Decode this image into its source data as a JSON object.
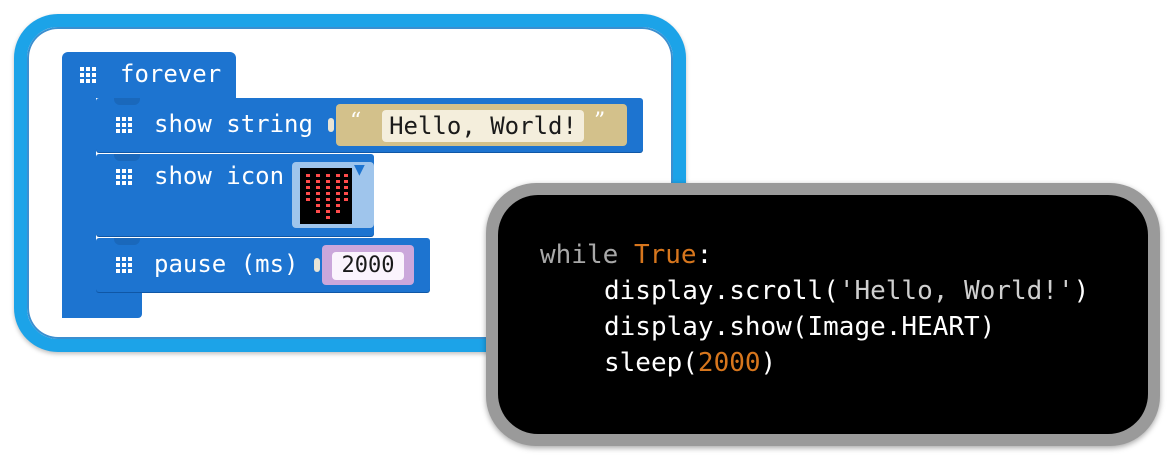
{
  "blocks": {
    "forever_label": "forever",
    "show_string_label": "show string",
    "string_value": "Hello, World!",
    "open_quote": "“",
    "close_quote": "”",
    "show_icon_label": "show icon",
    "icon_dropdown": "▼",
    "pause_label": "pause (ms)",
    "pause_value": "2000",
    "colors": {
      "block": "#1d74d0",
      "string_slot": "#d3c18b",
      "number_slot": "#cba7db",
      "icon_slot": "#9fc5ec",
      "panel_border": "#1ca3e8"
    }
  },
  "code": {
    "line1_kw": "while",
    "line1_const": "True",
    "line1_rest": ":",
    "line2": "display.scroll(",
    "line2_str": "'Hello, World!'",
    "line2_end": ")",
    "line3": "display.show(Image.HEART)",
    "line4_a": "sleep(",
    "line4_num": "2000",
    "line4_b": ")",
    "colors": {
      "keyword": "#a8a8a8",
      "constant": "#d7761d",
      "text": "#ffffff",
      "background": "#000000"
    }
  }
}
